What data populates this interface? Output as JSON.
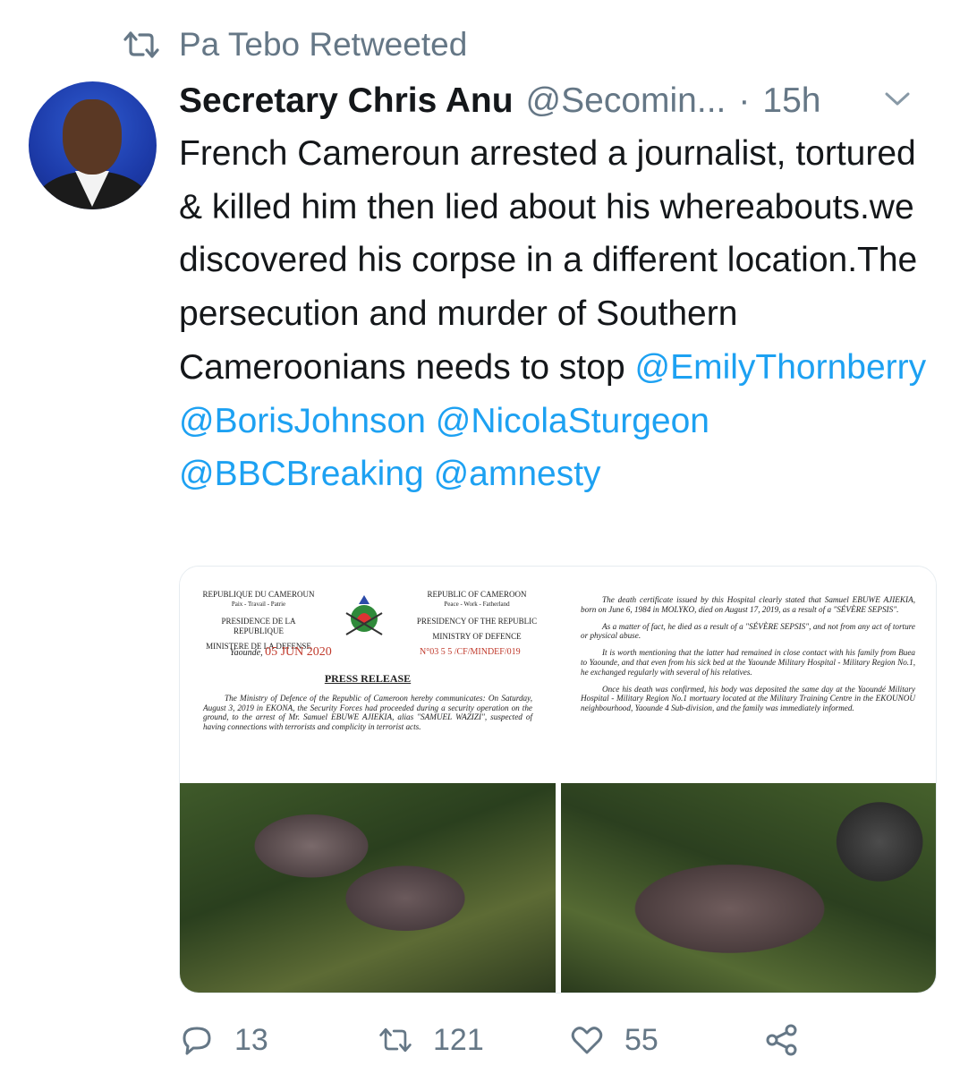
{
  "retweet": {
    "label": "Pa Tebo Retweeted",
    "icon": "retweet-icon"
  },
  "tweet": {
    "author_name": "Secretary Chris Anu",
    "handle": "@Secomin...",
    "separator": "·",
    "time": "15h",
    "text_plain": "French Cameroun arrested a journalist, tortured & killed him then lied about his whereabouts.we discovered his corpse in a different location.The persecution and murder of Southern Cameroonians needs to stop ",
    "mentions": [
      "@EmilyThornberry",
      "@BorisJohnson",
      "@NicolaSturgeon",
      "@BBCBreaking",
      "@amnesty"
    ]
  },
  "document_left": {
    "left_header": [
      "REPUBLIQUE DU CAMEROUN",
      "Paix - Travail - Patrie",
      "PRESIDENCE DE LA REPUBLIQUE",
      "MINISTERE DE LA DEFENSE"
    ],
    "right_header": [
      "REPUBLIC OF CAMEROON",
      "Peace - Work - Fatherland",
      "PRESIDENCY OF THE REPUBLIC",
      "MINISTRY OF DEFENCE"
    ],
    "place": "Yaounde,",
    "date_stamp": "05 JUN 2020",
    "ref": "N°03 5 5 /CF/MINDEF/019",
    "title": "PRESS RELEASE",
    "body": "The Ministry of Defence of the Republic of Cameroon hereby communicates: On Saturday, August 3, 2019 in EKONA, the Security Forces had proceeded during a security operation on the ground, to the arrest of Mr. Samuel EBUWE AJIEKIA, alias \"SAMUEL WAZIZI\", suspected of having connections with terrorists and complicity in terrorist acts."
  },
  "document_right": {
    "paragraphs": [
      "The death certificate issued by this Hospital clearly stated that Samuel EBUWE AJIEKIA, born on June 6, 1984 in MOLYKO, died on August 17, 2019, as a result of a \"SÉVÈRE SEPSIS\".",
      "As a matter of fact, he died as a result of a \"SÉVÈRE SEPSIS\", and not from any act of torture or physical abuse.",
      "It is worth mentioning that the latter had remained in close contact with his family from Buea to Yaounde, and that even from his sick bed at the Yaounde Military Hospital - Military Region No.1, he exchanged regularly with several of his relatives.",
      "Once his death was confirmed, his body was deposited the same day at the Yaoundé Military Hospital - Military Region No.1 mortuary located at the Military Training Centre in the EKOUNOU neighbourhood, Yaounde 4 Sub-division, and the family was immediately informed."
    ]
  },
  "actions": {
    "replies": "13",
    "retweets": "121",
    "likes": "55"
  },
  "colors": {
    "link": "#1da1f2",
    "muted": "#657786",
    "text": "#14171a"
  }
}
